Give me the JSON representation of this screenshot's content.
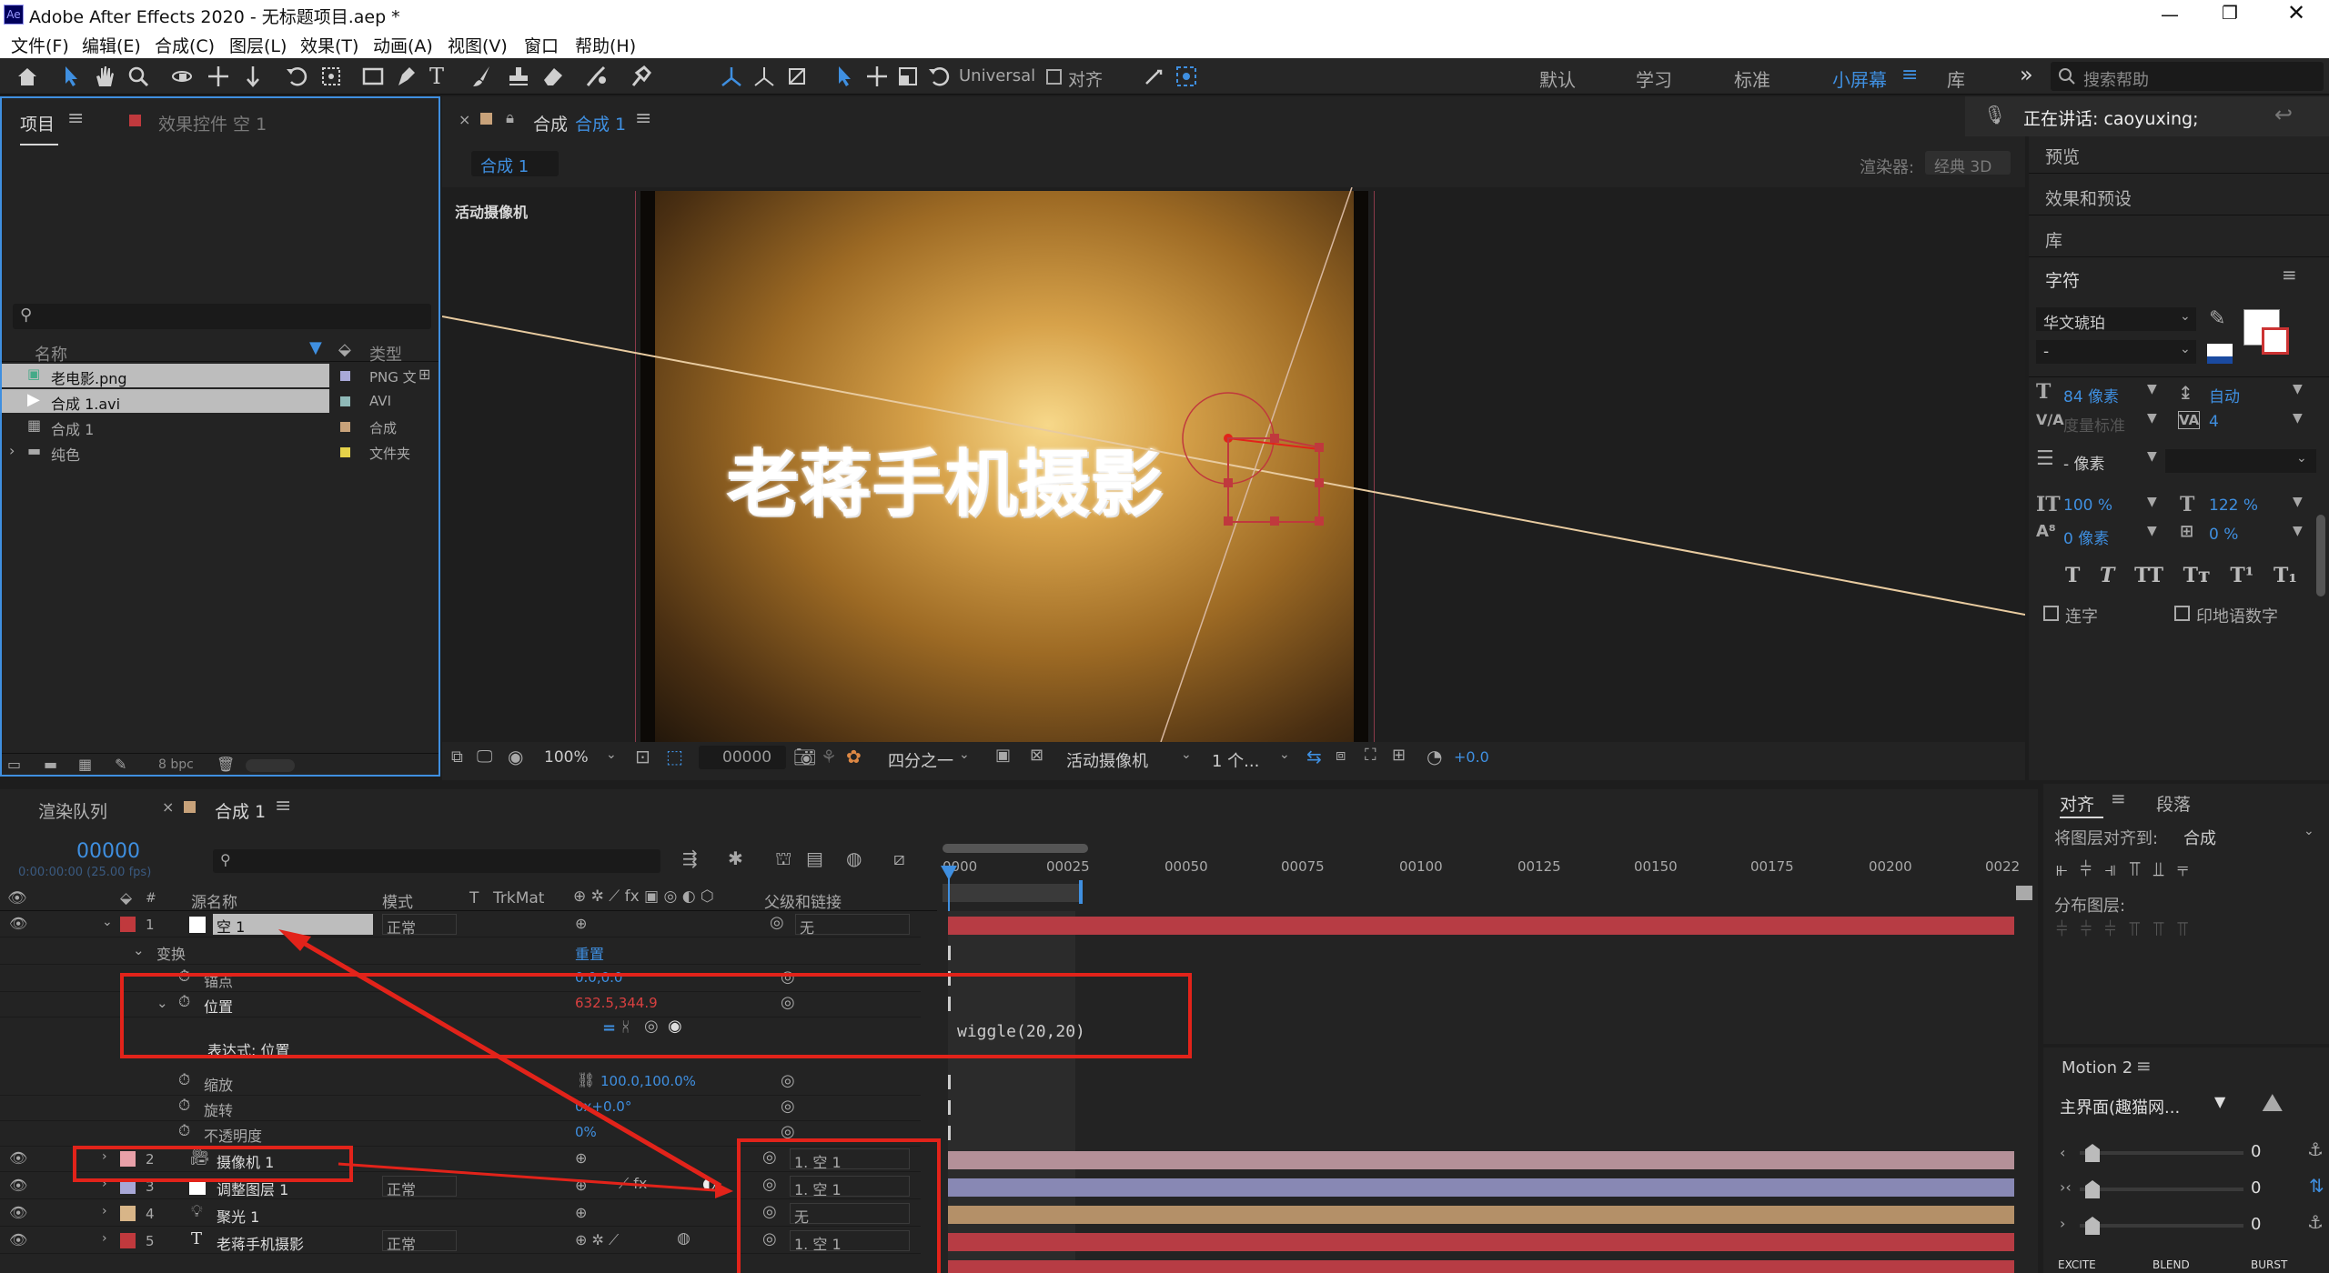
{
  "app": {
    "title": "Adobe After Effects 2020 - 无标题项目.aep *",
    "logo": "Ae"
  },
  "menu": [
    "文件(F)",
    "编辑(E)",
    "合成(C)",
    "图层(L)",
    "效果(T)",
    "动画(A)",
    "视图(V)",
    "窗口",
    "帮助(H)"
  ],
  "toolbar": {
    "universal": "Universal",
    "align": "对齐",
    "workspaces": [
      "默认",
      "学习",
      "标准",
      "小屏幕",
      "库"
    ],
    "search_placeholder": "搜索帮助"
  },
  "project": {
    "tab": "项目",
    "effects_tab": "效果控件 空 1",
    "col_name": "名称",
    "col_type": "类型",
    "bpc": "8 bpc",
    "items": [
      {
        "name": "老电影.png",
        "type": "PNG 文",
        "color": "#a9a9d8"
      },
      {
        "name": "合成 1.avi",
        "type": "AVI",
        "color": "#8fb9b8"
      },
      {
        "name": "合成 1",
        "type": "合成",
        "color": "#c8a27a"
      },
      {
        "name": "纯色",
        "type": "文件夹",
        "color": "#e5d24a"
      }
    ]
  },
  "comp": {
    "tab_prefix": "合成",
    "tab_name": "合成 1",
    "breadcrumb": "合成 1",
    "renderer_label": "渲染器:",
    "renderer": "经典 3D",
    "camera_label": "活动摄像机",
    "canvas_text": "老蒋手机摄影",
    "bottom": {
      "zoom": "100%",
      "timecode": "00000",
      "resolution": "四分之一",
      "view": "活动摄像机",
      "views": "1 个...",
      "offset": "+0.0"
    }
  },
  "right": {
    "speaking": "正在讲话: caoyuxing;",
    "preview": "预览",
    "effects": "效果和预设",
    "library": "库",
    "character": "字符",
    "font": "华文琥珀",
    "font_style": "-",
    "size": "84 像素",
    "leading": "自动",
    "kerning": "度量标准",
    "tracking": "4",
    "stroke": "- 像素",
    "vscale": "100 %",
    "hscale": "122 %",
    "baseline": "0 像素",
    "tsume": "0 %",
    "ligature": "连字",
    "hindi": "印地语数字"
  },
  "timeline": {
    "render_tab": "渲染队列",
    "comp_tab": "合成 1",
    "timecode": "00000",
    "fps": "0:00:00:00 (25.00 fps)",
    "col_source": "源名称",
    "col_mode": "模式",
    "col_t": "T",
    "col_trkmat": "TrkMat",
    "col_parent": "父级和链接",
    "ruler": [
      "0000",
      "00025",
      "00050",
      "00075",
      "00100",
      "00125",
      "00150",
      "00175",
      "00200",
      "0022"
    ],
    "layers": [
      {
        "num": "1",
        "name": "空 1",
        "mode": "正常",
        "parent": "无",
        "color": "#c0393d"
      },
      {
        "num": "2",
        "name": "摄像机 1",
        "mode": "",
        "parent": "1. 空 1",
        "color": "#e8a0a8"
      },
      {
        "num": "3",
        "name": "调整图层 1",
        "mode": "正常",
        "parent": "1. 空 1",
        "color": "#a7a7d6"
      },
      {
        "num": "4",
        "name": "聚光 1",
        "mode": "",
        "parent": "无",
        "color": "#d8b588"
      },
      {
        "num": "5",
        "name": "老蒋手机摄影",
        "mode": "正常",
        "parent": "1. 空 1",
        "color": "#c0393d"
      }
    ],
    "transform": "变换",
    "reset": "重置",
    "anchor": "锚点",
    "anchor_val": "0.0,0.0",
    "position": "位置",
    "position_val": "632.5,344.9",
    "expression_label": "表达式: 位置",
    "expression": "wiggle(20,20)",
    "scale": "缩放",
    "scale_val": "100.0,100.0%",
    "rotation": "旋转",
    "rotation_val": "0x+0.0°",
    "opacity": "不透明度",
    "opacity_val": "0%"
  },
  "align": {
    "tab": "对齐",
    "para_tab": "段落",
    "align_to_label": "将图层对齐到:",
    "align_to": "合成",
    "distribute": "分布图层:"
  },
  "motion": {
    "title": "Motion 2",
    "preset": "主界面(趣猫网...",
    "values": [
      "0",
      "0",
      "0"
    ],
    "buttons": [
      "EXCITE",
      "BLEND",
      "BURST"
    ]
  },
  "colors": {
    "accent": "#3f8fe0",
    "annotation": "#e2231a",
    "layer_red": "#c0393d"
  }
}
